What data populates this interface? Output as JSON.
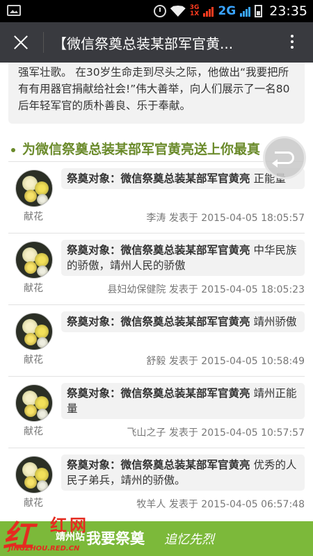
{
  "status_bar": {
    "network_small": "3G\n1X",
    "network": "2G",
    "time": "23:35"
  },
  "title_bar": {
    "title": "【微信祭奠总装某部军官黄..."
  },
  "intro": {
    "text": "强军壮歌。 在30岁生命走到尽头之际，他做出“我要把所有有用器官捐献给社会!”伟大善举，向人们展示了一名80后年轻军官的质朴善良、乐于奉献。"
  },
  "section": {
    "title": "为微信祭奠总装某部军官黄亮送上你最真"
  },
  "messages": [
    {
      "avatar_label": "献花",
      "prefix": "祭奠对象：微信祭奠总装某部军官黄亮",
      "text": " 正能量",
      "author": "李涛",
      "posted_label": "发表于",
      "time": "2015-04-05 18:05:57"
    },
    {
      "avatar_label": "献花",
      "prefix": "祭奠对象：微信祭奠总装某部军官黄亮",
      "text": " 中华民族的骄傲，靖州人民的骄傲",
      "author": "县妇幼保健院",
      "posted_label": "发表于",
      "time": "2015-04-05 18:05:23"
    },
    {
      "avatar_label": "献花",
      "prefix": "祭奠对象：微信祭奠总装某部军官黄亮",
      "text": " 靖州骄傲",
      "author": "舒毅",
      "posted_label": "发表于",
      "time": "2015-04-05 10:58:49"
    },
    {
      "avatar_label": "献花",
      "prefix": "祭奠对象：微信祭奠总装某部军官黄亮",
      "text": " 靖州正能量",
      "author": "飞山之子",
      "posted_label": "发表于",
      "time": "2015-04-05 10:57:57"
    },
    {
      "avatar_label": "献花",
      "prefix": "祭奠对象：微信祭奠总装某部军官黄亮",
      "text": " 优秀的人民子弟兵，靖州的骄傲。",
      "author": "牧羊人",
      "posted_label": "发表于",
      "time": "2015-04-05 06:57:48"
    }
  ],
  "footer": {
    "button": "我要祭奠",
    "slogan": "追忆先烈"
  },
  "watermark": {
    "mark": "红",
    "name": "红网",
    "station": "靖州站",
    "url": "JINGZHOU.RED.CN"
  },
  "colors": {
    "title_bar": "#393a3f",
    "accent_green": "#6a8a2a",
    "footer": "#7cb93a",
    "watermark_red": "#e52b20"
  }
}
